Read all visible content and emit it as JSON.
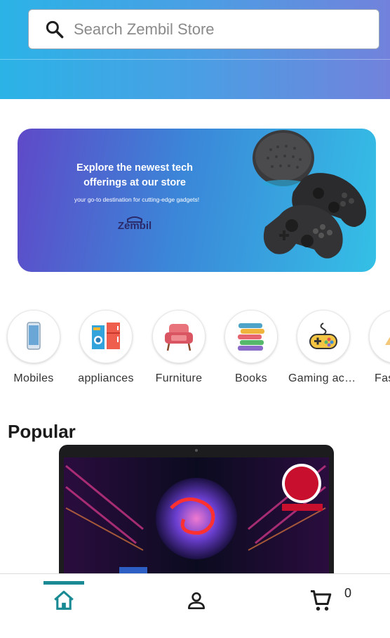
{
  "search": {
    "placeholder": "Search Zembil Store"
  },
  "banner": {
    "headline_line1": "Explore the newest tech",
    "headline_line2": "offerings at our store",
    "subline": "your go-to destination for cutting-edge gadgets!",
    "logo_text": "Zembil"
  },
  "categories": [
    {
      "label": "Mobiles",
      "icon": "mobile-phone-icon"
    },
    {
      "label": "appliances",
      "icon": "appliances-icon"
    },
    {
      "label": "Furniture",
      "icon": "armchair-icon"
    },
    {
      "label": "Books",
      "icon": "books-icon"
    },
    {
      "label": "Gaming accessories",
      "icon": "gamepad-icon"
    },
    {
      "label": "Fashion",
      "icon": "fashion-icon"
    }
  ],
  "popular": {
    "title": "Popular"
  },
  "nav": {
    "cart_count": "0"
  },
  "colors": {
    "accent": "#198a93",
    "header_start": "#2bb3e6",
    "header_end": "#7282dc"
  }
}
